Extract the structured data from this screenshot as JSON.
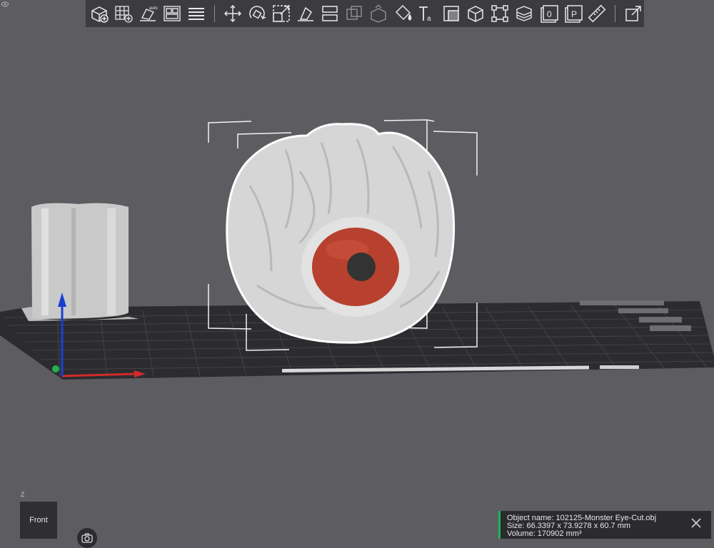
{
  "toolbar": {
    "group1": [
      "add-object-icon",
      "arrange-grid-icon",
      "auto-orient-icon",
      "layout-plates-icon",
      "layers-list-icon"
    ],
    "group2": [
      "move-icon",
      "rotate-icon",
      "scale-icon",
      "lay-on-face-icon",
      "split-icon",
      "cut-icon",
      "mesh-boolean-icon",
      "paint-icon",
      "text-icon",
      "height-range-icon",
      "cube-icon",
      "support-icon",
      "variable-layer-icon",
      "brim-icon",
      "seam-icon",
      "measure-icon"
    ],
    "group3": [
      "assembly-view-icon"
    ]
  },
  "viewport": {
    "view_label": "Front",
    "axis_label": "Z",
    "colors": {
      "background": "#5d5d61",
      "plate": "#2c2c30",
      "grid": "#4a4a4e",
      "model": "#d4d4d4",
      "iris": "#b8402e",
      "pupil": "#333333",
      "selection_outline": "#ffffff",
      "axis_x": "#d22b2b",
      "axis_y": "#22b14c",
      "axis_z": "#1a3fd0"
    }
  },
  "info_panel": {
    "object_name": "Object name: 102125-Monster Eye-Cut.obj",
    "size": "Size: 66.3397 x 73.9278 x 60.7 mm",
    "volume": "Volume: 170902 mm³",
    "accent_color": "#1fb25a"
  }
}
